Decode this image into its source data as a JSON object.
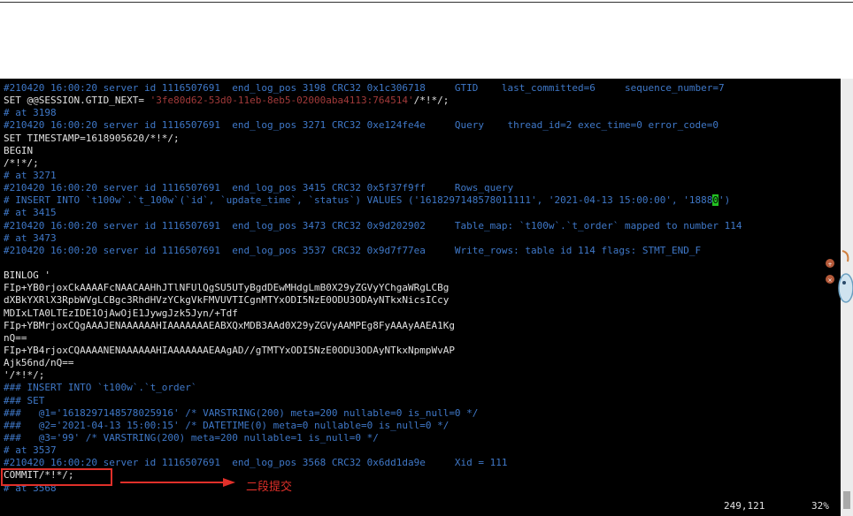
{
  "terminal": {
    "lines": [
      {
        "text": "#210420 16:00:20 server id 1116507691  end_log_pos 3198 CRC32 0x1c306718     GTID    last_committed=6     sequence_number=7",
        "color": "blue"
      },
      {
        "text": "SET @@SESSION.GTID_NEXT= '3fe80d62-53d0-11eb-8eb5-02000aba4113:764514'/*!*/;",
        "color": "white"
      },
      {
        "text": "# at 3198",
        "color": "blue"
      },
      {
        "text": "#210420 16:00:20 server id 1116507691  end_log_pos 3271 CRC32 0xe124fe4e     Query    thread_id=2 exec_time=0 error_code=0",
        "color": "blue"
      },
      {
        "text": "SET TIMESTAMP=1618905620/*!*/;",
        "color": "white"
      },
      {
        "text": "BEGIN",
        "color": "white"
      },
      {
        "text": "/*!*/;",
        "color": "white"
      },
      {
        "text": "# at 3271",
        "color": "blue"
      },
      {
        "text": "#210420 16:00:20 server id 1116507691  end_log_pos 3415 CRC32 0x5f37f9ff     Rows_query",
        "color": "blue"
      },
      {
        "text": "# INSERT INTO `t100w`.`t_100w`(`id`, `update_time`, `status`) VALUES ('1618297148578011111', '2021-04-13 15:00:00', '18880')",
        "color": "blue",
        "cursor": true
      },
      {
        "text": "# at 3415",
        "color": "blue"
      },
      {
        "text": "#210420 16:00:20 server id 1116507691  end_log_pos 3473 CRC32 0x9d202902     Table_map: `t100w`.`t_order` mapped to number 114",
        "color": "blue"
      },
      {
        "text": "# at 3473",
        "color": "blue"
      },
      {
        "text": "#210420 16:00:20 server id 1116507691  end_log_pos 3537 CRC32 0x9d7f77ea     Write_rows: table id 114 flags: STMT_END_F",
        "color": "blue"
      },
      {
        "text": "",
        "color": "white"
      },
      {
        "text": "BINLOG '",
        "color": "white"
      },
      {
        "text": "FIp+YB0rjoxCkAAAAFcNAACAAHhJTlNFUlQgSU5UTyBgdDEwMHdgLmB0X29yZGVyYChgaWRgLCBg",
        "color": "white"
      },
      {
        "text": "dXBkYXRlX3RpbWVgLCBgc3RhdHVzYCkgVkFMVUVTICgnMTYxODI5NzE0ODU3ODAyNTkxNicsICcy",
        "color": "white"
      },
      {
        "text": "MDIxLTA0LTEzIDE1OjAwOjE1JywgJzk5Jyn/+Tdf",
        "color": "white"
      },
      {
        "text": "FIp+YBMrjoxCQgAAAJENAAAAAAHIAAAAAAAEABXQxMDB3AAd0X29yZGVyAAMPEg8FyAAAyAAEA1Kg",
        "color": "white"
      },
      {
        "text": "nQ==",
        "color": "white"
      },
      {
        "text": "FIp+YB4rjoxCQAAAANENAAAAAAHIAAAAAAAEAAgAD//gTMTYxODI5NzE0ODU3ODAyNTkxNpmpWvAP",
        "color": "white"
      },
      {
        "text": "Ajk56nd/nQ==",
        "color": "white"
      },
      {
        "text": "'/*!*/;",
        "color": "white"
      },
      {
        "text": "### INSERT INTO `t100w`.`t_order`",
        "color": "blue"
      },
      {
        "text": "### SET",
        "color": "blue"
      },
      {
        "text": "###   @1='1618297148578025916' /* VARSTRING(200) meta=200 nullable=0 is_null=0 */",
        "color": "blue"
      },
      {
        "text": "###   @2='2021-04-13 15:00:15' /* DATETIME(0) meta=0 nullable=0 is_null=0 */",
        "color": "blue"
      },
      {
        "text": "###   @3='99' /* VARSTRING(200) meta=200 nullable=1 is_null=0 */",
        "color": "blue"
      },
      {
        "text": "# at 3537",
        "color": "blue"
      },
      {
        "text": "#210420 16:00:20 server id 1116507691  end_log_pos 3568 CRC32 0x6dd1da9e     Xid = 111",
        "color": "blue"
      },
      {
        "text": "COMMIT/*!*/;",
        "color": "white"
      },
      {
        "text": "# at 3568",
        "color": "blue"
      }
    ],
    "status_position": "249,121",
    "status_percent": "32%"
  },
  "annotation": {
    "label": "二段提交",
    "color": "#e0302a"
  },
  "colors": {
    "blue": "#3f78c8",
    "white": "#e2e2e2",
    "red_string": "#a23a3a",
    "cursor": "#22c122"
  }
}
